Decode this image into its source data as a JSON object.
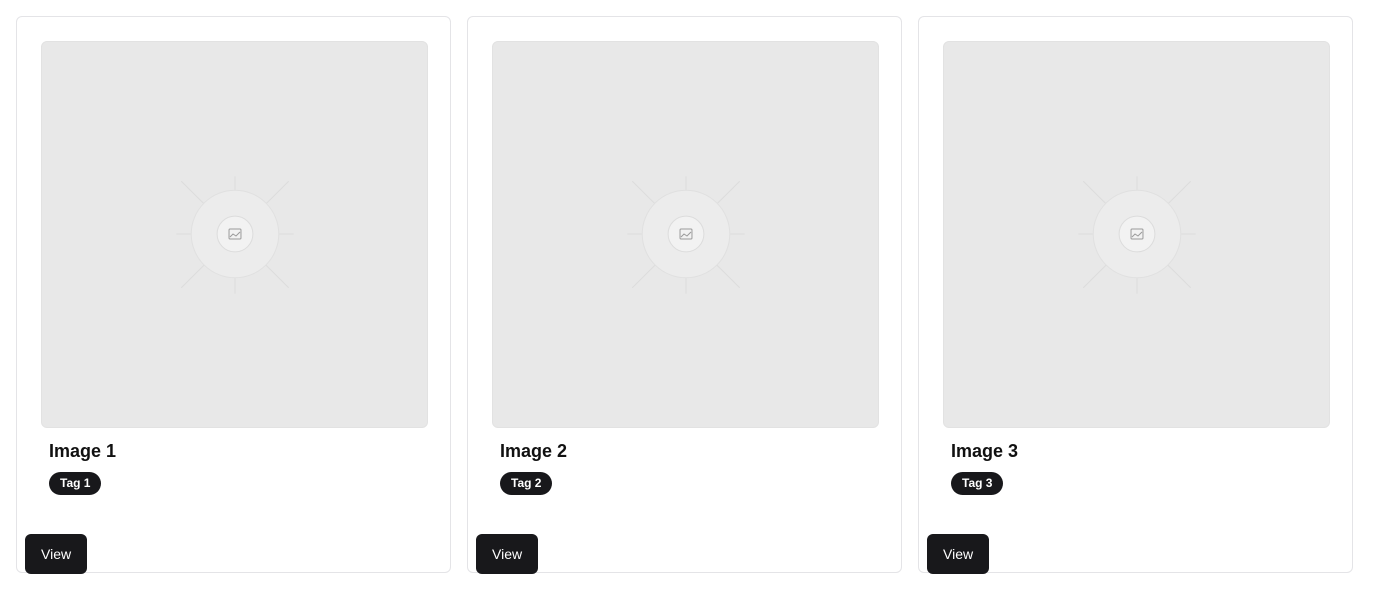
{
  "cards": [
    {
      "title": "Image 1",
      "tag": "Tag 1",
      "button_label": "View",
      "image_icon": "image-placeholder-icon"
    },
    {
      "title": "Image 2",
      "tag": "Tag 2",
      "button_label": "View",
      "image_icon": "image-placeholder-icon"
    },
    {
      "title": "Image 3",
      "tag": "Tag 3",
      "button_label": "View",
      "image_icon": "image-placeholder-icon"
    }
  ],
  "colors": {
    "placeholder_bg": "#e8e8e8",
    "badge_bg": "#18181b",
    "button_bg": "#18181b",
    "card_border": "#e4e4e7"
  }
}
